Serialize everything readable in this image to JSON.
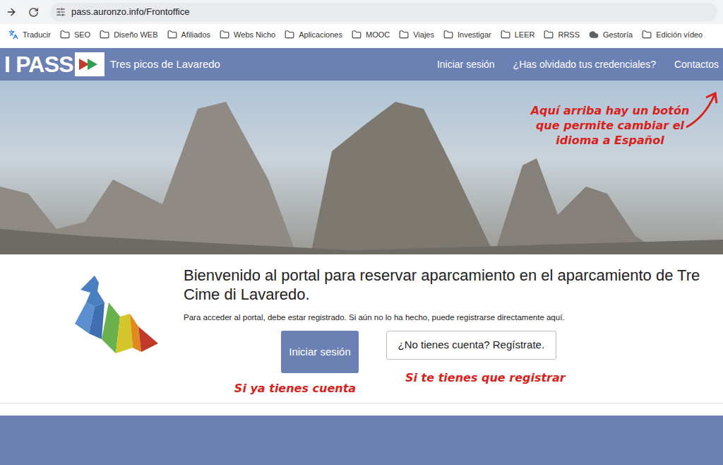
{
  "browser": {
    "url": "pass.auronzo.info/Frontoffice",
    "bookmarks": [
      {
        "label": "Traducir",
        "kind": "translate"
      },
      {
        "label": "SEO",
        "kind": "folder"
      },
      {
        "label": "Diseño WEB",
        "kind": "folder"
      },
      {
        "label": "Afiliados",
        "kind": "folder"
      },
      {
        "label": "Webs Nicho",
        "kind": "folder"
      },
      {
        "label": "Aplicaciones",
        "kind": "folder"
      },
      {
        "label": "MOOC",
        "kind": "folder"
      },
      {
        "label": "Viajes",
        "kind": "folder"
      },
      {
        "label": "Investigar",
        "kind": "folder"
      },
      {
        "label": "LEER",
        "kind": "folder"
      },
      {
        "label": "RRSS",
        "kind": "folder"
      },
      {
        "label": "Gestoría",
        "kind": "cloud"
      },
      {
        "label": "Edición vídeo",
        "kind": "folder"
      }
    ]
  },
  "site_nav": {
    "logo": "I PASS",
    "subtitle": "Tres picos de Lavaredo",
    "links": [
      "Iniciar sesión",
      "¿Has olvidado tus credenciales?",
      "Contactos"
    ]
  },
  "hero": {
    "annotation": "Aquí arriba hay un botón que permite cambiar el idioma a Español"
  },
  "welcome": {
    "heading": "Bienvenido al portal para reservar aparcamiento en el aparcamiento de Tre Cime di Lavaredo.",
    "text": "Para acceder al portal, debe estar registrado. Si aún no lo ha hecho, puede registrarse directamente aquí.",
    "buttons": [
      {
        "label": "Iniciar sesión",
        "kind": "primary",
        "annotation": "Si ya tienes cuenta"
      },
      {
        "label": "¿No tienes cuenta? Regístrate.",
        "kind": "secondary",
        "annotation": "Si te tienes que registrar"
      }
    ]
  }
}
